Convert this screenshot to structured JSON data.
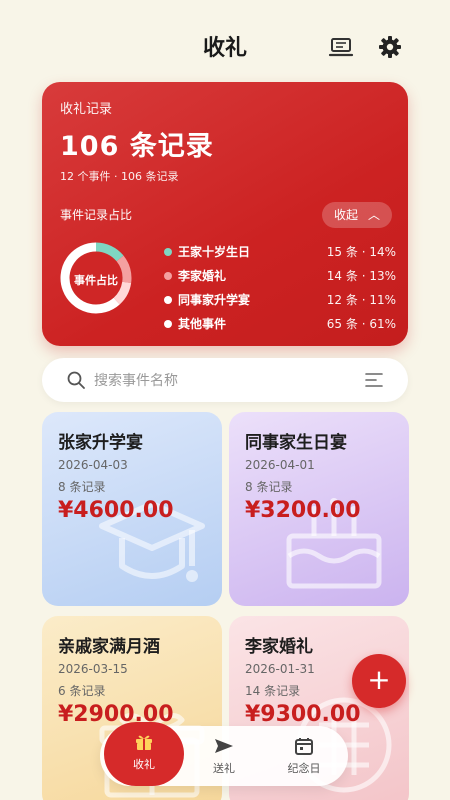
{
  "header": {
    "title": "收礼",
    "icons": [
      "laptop-icon",
      "gear-icon"
    ]
  },
  "summary": {
    "label": "收礼记录",
    "total_text": "106 条记录",
    "sub_text": "12 个事件 · 106 条记录",
    "section_title": "事件记录占比",
    "collapse_label": "收起",
    "donut_label": "事件占比",
    "legend": [
      {
        "name": "王家十岁生日",
        "stat": "15 条 · 14%",
        "percent": 14,
        "color": "#7fd6c2"
      },
      {
        "name": "李家婚礼",
        "stat": "14 条 · 13%",
        "percent": 13,
        "color": "#f4a0a0"
      },
      {
        "name": "同事家升学宴",
        "stat": "12 条 · 11%",
        "percent": 11,
        "color": "#ffffff"
      },
      {
        "name": "其他事件",
        "stat": "65 条 · 61%",
        "percent": 61,
        "color": "#ffffff"
      }
    ]
  },
  "search": {
    "placeholder": "搜索事件名称"
  },
  "events": [
    {
      "name": "张家升学宴",
      "date": "2026-04-03",
      "count": "8 条记录",
      "amount": "¥4600.00"
    },
    {
      "name": "同事家生日宴",
      "date": "2026-04-01",
      "count": "8 条记录",
      "amount": "¥3200.00"
    },
    {
      "name": "亲戚家满月酒",
      "date": "2026-03-15",
      "count": "6 条记录",
      "amount": "¥2900.00"
    },
    {
      "name": "李家婚礼",
      "date": "2026-01-31",
      "count": "14 条记录",
      "amount": "¥9300.00"
    }
  ],
  "fab": {
    "label": "+"
  },
  "nav": [
    {
      "label": "收礼",
      "icon": "gift-icon",
      "active": true
    },
    {
      "label": "送礼",
      "icon": "send-icon",
      "active": false
    },
    {
      "label": "纪念日",
      "icon": "calendar-icon",
      "active": false
    }
  ],
  "colors": {
    "accent": "#d62a2a",
    "background": "#f8f5e8"
  }
}
